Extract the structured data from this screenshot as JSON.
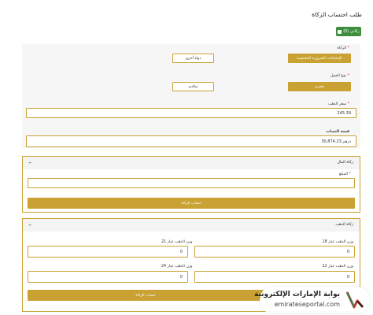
{
  "page": {
    "title": "طلب احتساب الزكاة"
  },
  "cart": {
    "label": "زكاتي (0)"
  },
  "zakat_type": {
    "label": "الزكاة",
    "required_mark": "*",
    "option_selected": "الإحتياجات الضرورية المحتسبة",
    "option_other": "دولة أخرى"
  },
  "calendar": {
    "label": "نوع الحول",
    "required_mark": "*",
    "option_selected": "هجري",
    "option_other": "ميلادي"
  },
  "gold_name": {
    "label": "سعر الذهب",
    "required_mark": "*",
    "value": "245.39"
  },
  "nisab": {
    "label": "قيمة النصاب",
    "value": "30,874.23 درهم"
  },
  "cash_section": {
    "title": "زكاة المال",
    "toggle_glyph": "–",
    "amount_label": "المبلغ",
    "required_mark": "*",
    "amount_value": "",
    "calc_button": "حساب الزكاة"
  },
  "gold_section": {
    "title": "زكاة الذهب",
    "toggle_glyph": "–",
    "fields": [
      {
        "label": "وزن الذهب عيار 18",
        "value": "0"
      },
      {
        "label": "وزن الذهب عيار 21",
        "value": "0"
      },
      {
        "label": "وزن الذهب عيار 22",
        "value": "0"
      },
      {
        "label": "وزن الذهب عيار 24",
        "value": "0"
      }
    ],
    "calc_button": "حساب الزكاة"
  },
  "watermark": {
    "arabic": "بوابة الإمارات الإلكترونية",
    "english": "emirateseportal.com"
  },
  "colors": {
    "accent": "#c9a233",
    "cart_green": "#3d8f3d",
    "panel_bg": "#f6f6f6"
  },
  "icons": [
    "shopping-bag-icon",
    "minus-icon",
    "logo-icon"
  ]
}
